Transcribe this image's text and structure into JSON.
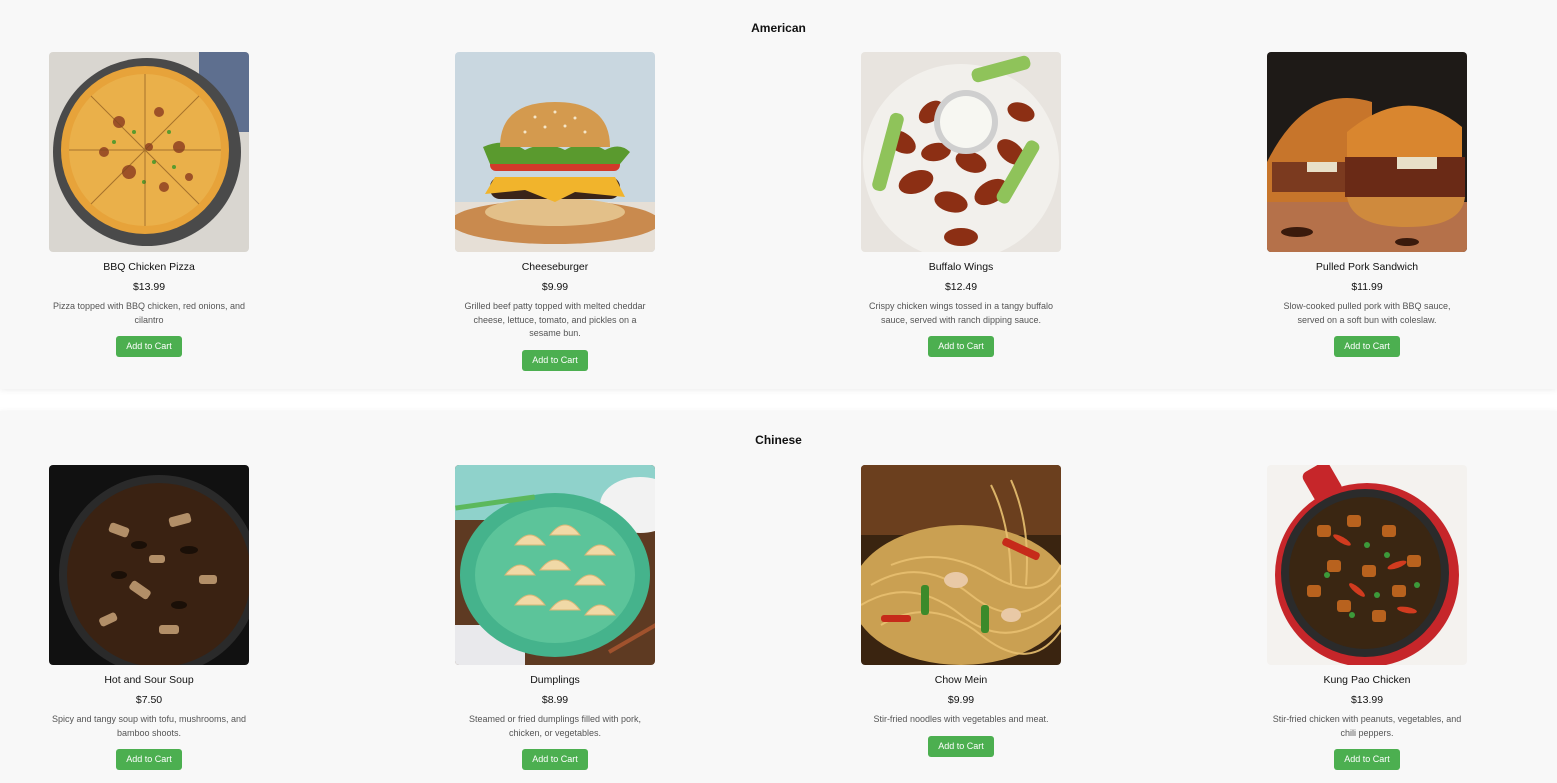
{
  "categories": [
    {
      "name": "American",
      "items": [
        {
          "name": "BBQ Chicken Pizza",
          "price": "$13.99",
          "description": "Pizza topped with BBQ chicken, red onions, and cilantro",
          "button": "Add to Cart",
          "image": "bbq-chicken-pizza-image"
        },
        {
          "name": "Cheeseburger",
          "price": "$9.99",
          "description": "Grilled beef patty topped with melted cheddar cheese, lettuce, tomato, and pickles on a sesame bun.",
          "button": "Add to Cart",
          "image": "cheeseburger-image"
        },
        {
          "name": "Buffalo Wings",
          "price": "$12.49",
          "description": "Crispy chicken wings tossed in a tangy buffalo sauce, served with ranch dipping sauce.",
          "button": "Add to Cart",
          "image": "buffalo-wings-image"
        },
        {
          "name": "Pulled Pork Sandwich",
          "price": "$11.99",
          "description": "Slow-cooked pulled pork with BBQ sauce, served on a soft bun with coleslaw.",
          "button": "Add to Cart",
          "image": "pulled-pork-sandwich-image"
        }
      ]
    },
    {
      "name": "Chinese",
      "items": [
        {
          "name": "Hot and Sour Soup",
          "price": "$7.50",
          "description": "Spicy and tangy soup with tofu, mushrooms, and bamboo shoots.",
          "button": "Add to Cart",
          "image": "hot-and-sour-soup-image"
        },
        {
          "name": "Dumplings",
          "price": "$8.99",
          "description": "Steamed or fried dumplings filled with pork, chicken, or vegetables.",
          "button": "Add to Cart",
          "image": "dumplings-image"
        },
        {
          "name": "Chow Mein",
          "price": "$9.99",
          "description": "Stir-fried noodles with vegetables and meat.",
          "button": "Add to Cart",
          "image": "chow-mein-image"
        },
        {
          "name": "Kung Pao Chicken",
          "price": "$13.99",
          "description": "Stir-fried chicken with peanuts, vegetables, and chili peppers.",
          "button": "Add to Cart",
          "image": "kung-pao-chicken-image"
        }
      ]
    }
  ],
  "colors": {
    "button_bg": "#4caf50",
    "button_text": "#ffffff",
    "section_bg": "#f8f8f8"
  }
}
